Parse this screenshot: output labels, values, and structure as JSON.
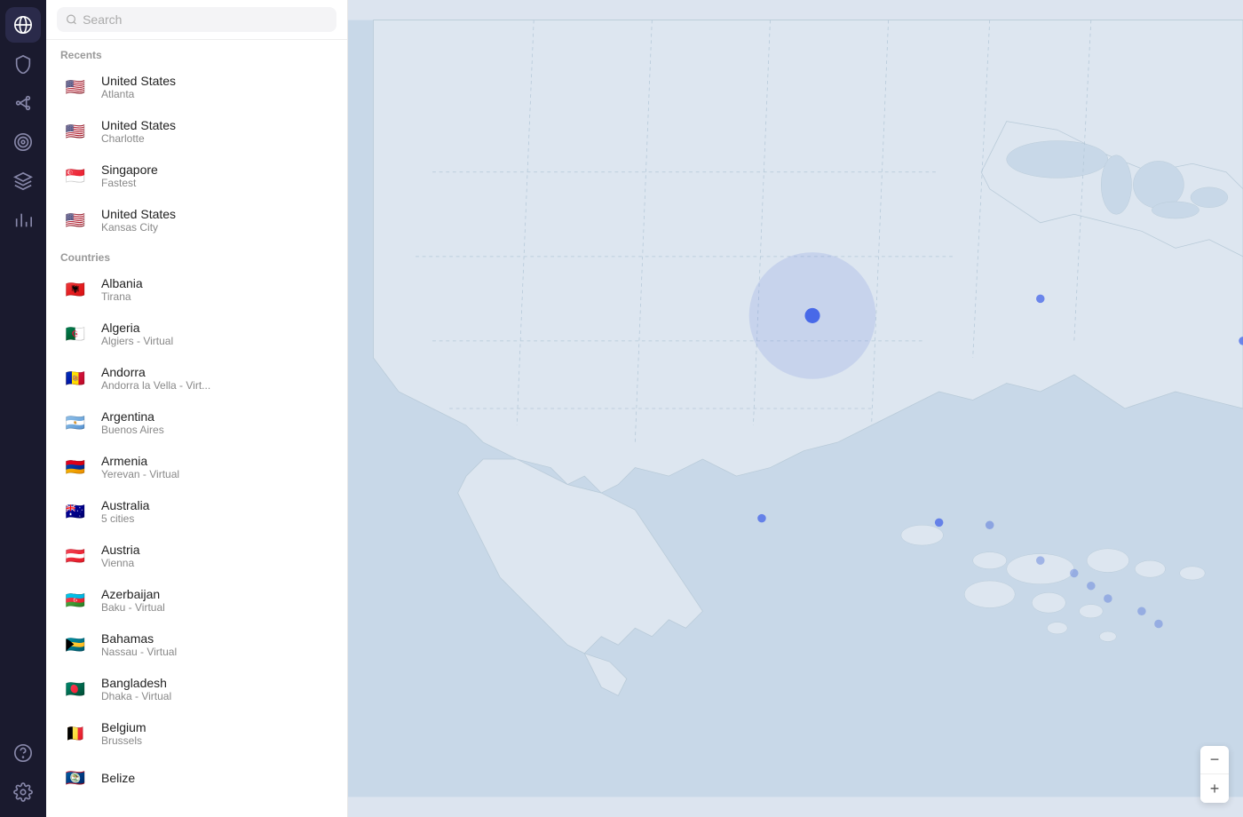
{
  "sidebar": {
    "items": [
      {
        "name": "globe-icon",
        "label": "Locations",
        "active": true
      },
      {
        "name": "shield-icon",
        "label": "Security"
      },
      {
        "name": "mesh-icon",
        "label": "Mesh"
      },
      {
        "name": "target-icon",
        "label": "Targets"
      },
      {
        "name": "layers-icon",
        "label": "Layers"
      },
      {
        "name": "stats-icon",
        "label": "Stats"
      }
    ],
    "bottom": [
      {
        "name": "help-icon",
        "label": "Help"
      },
      {
        "name": "settings-icon",
        "label": "Settings"
      }
    ]
  },
  "search": {
    "placeholder": "Search",
    "value": ""
  },
  "recents": {
    "label": "Recents",
    "items": [
      {
        "country": "United States",
        "city": "Atlanta",
        "flag": "🇺🇸"
      },
      {
        "country": "United States",
        "city": "Charlotte",
        "flag": "🇺🇸"
      },
      {
        "country": "Singapore",
        "city": "Fastest",
        "flag": "🇸🇬"
      },
      {
        "country": "United States",
        "city": "Kansas City",
        "flag": "🇺🇸"
      }
    ]
  },
  "countries": {
    "label": "Countries",
    "items": [
      {
        "country": "Albania",
        "city": "Tirana",
        "flag": "🇦🇱"
      },
      {
        "country": "Algeria",
        "city": "Algiers - Virtual",
        "flag": "🇩🇿"
      },
      {
        "country": "Andorra",
        "city": "Andorra la Vella - Virt...",
        "flag": "🇦🇩"
      },
      {
        "country": "Argentina",
        "city": "Buenos Aires",
        "flag": "🇦🇷"
      },
      {
        "country": "Armenia",
        "city": "Yerevan - Virtual",
        "flag": "🇦🇲"
      },
      {
        "country": "Australia",
        "city": "5 cities",
        "flag": "🇦🇺"
      },
      {
        "country": "Austria",
        "city": "Vienna",
        "flag": "🇦🇹"
      },
      {
        "country": "Azerbaijan",
        "city": "Baku - Virtual",
        "flag": "🇦🇿"
      },
      {
        "country": "Bahamas",
        "city": "Nassau - Virtual",
        "flag": "🇧🇸"
      },
      {
        "country": "Bangladesh",
        "city": "Dhaka - Virtual",
        "flag": "🇧🇩"
      },
      {
        "country": "Belgium",
        "city": "Brussels",
        "flag": "🇧🇪"
      },
      {
        "country": "Belize",
        "city": "",
        "flag": "🇧🇿"
      }
    ]
  },
  "map_controls": {
    "zoom_out": "−",
    "zoom_in": "+"
  }
}
